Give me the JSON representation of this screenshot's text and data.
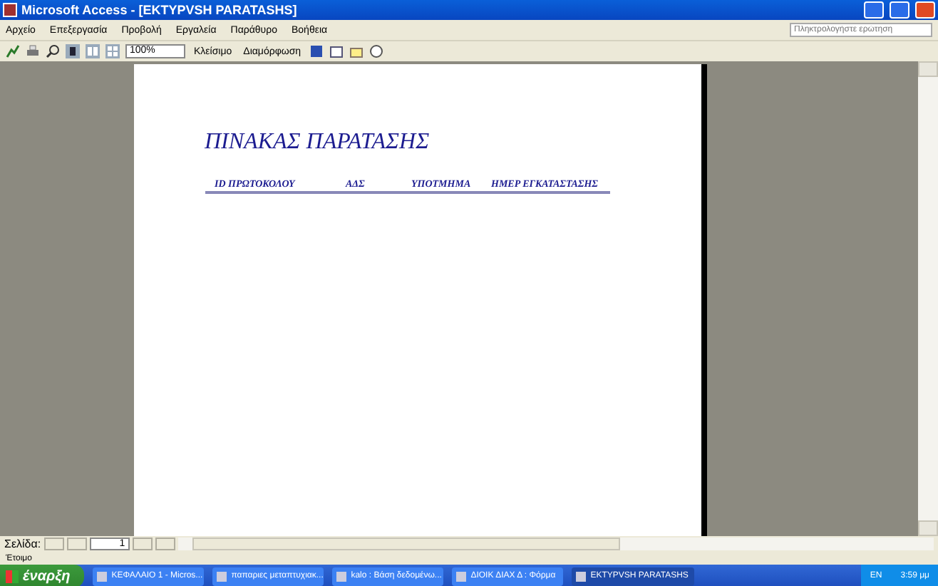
{
  "window": {
    "title": "Microsoft Access - [EKTYPVSH PARATASHS]"
  },
  "menu": [
    {
      "label": "Αρχείο"
    },
    {
      "label": "Επεξεργασία"
    },
    {
      "label": "Προβολή"
    },
    {
      "label": "Εργαλεία"
    },
    {
      "label": "Παράθυρο"
    },
    {
      "label": "Βοήθεια"
    }
  ],
  "help_box": {
    "placeholder": "Πληκτρολογήστε ερώτηση"
  },
  "toolbar": {
    "zoom": "100%",
    "close_button": "Κλείσιμο",
    "setup_button": "Διαμόρφωση"
  },
  "report": {
    "title": "ΠΙΝΑΚΑΣ ΠΑΡΑΤΑΣΗΣ",
    "columns": [
      "ID ΠΡΩΤΟΚΟΛΟΥ",
      "ΑΔΣ",
      "ΥΠΟΤΜΗΜΑ",
      "ΗΜΕΡ ΕΓΚΑΤΑΣΤΑΣΗΣ"
    ]
  },
  "navigation": {
    "label": "Σελίδα:",
    "page": "1"
  },
  "status_bar": "Έτοιμο",
  "taskbar": {
    "start": "έναρξη",
    "items": [
      {
        "label": "ΚΕΦΑΛΑΙΟ 1 - Micros...",
        "selected": false
      },
      {
        "label": "παπαριες μεταπτυχιακ...",
        "selected": false
      },
      {
        "label": "kalo : Βάση δεδομένω...",
        "selected": false
      },
      {
        "label": "ΔΙΟΙΚ ΔΙΑΧ Δ : Φόρμα",
        "selected": false
      },
      {
        "label": "EKTYPVSH PARATASHS",
        "selected": true
      }
    ],
    "language": "EN",
    "clock": "3:59 μμ"
  }
}
